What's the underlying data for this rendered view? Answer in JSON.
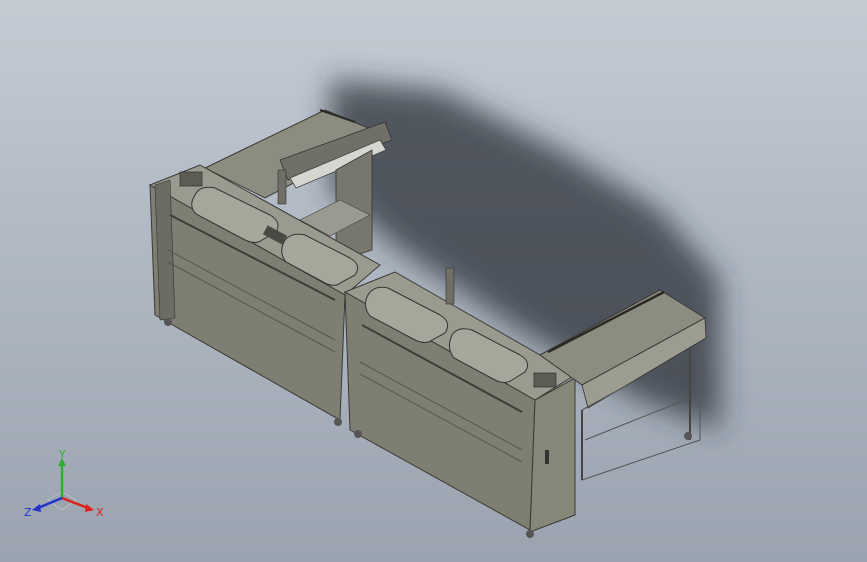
{
  "view": {
    "background_top": "#c4cbd3",
    "background_bottom": "#9aa3af",
    "model_color": "#85857a",
    "shadow_color": "#3a3e45"
  },
  "triad": {
    "x_label": "X",
    "y_label": "Y",
    "z_label": "Z",
    "x_color": "#e0201a",
    "y_color": "#2fae2f",
    "z_color": "#2233cc",
    "icon": "coordinate-triad-icon"
  }
}
